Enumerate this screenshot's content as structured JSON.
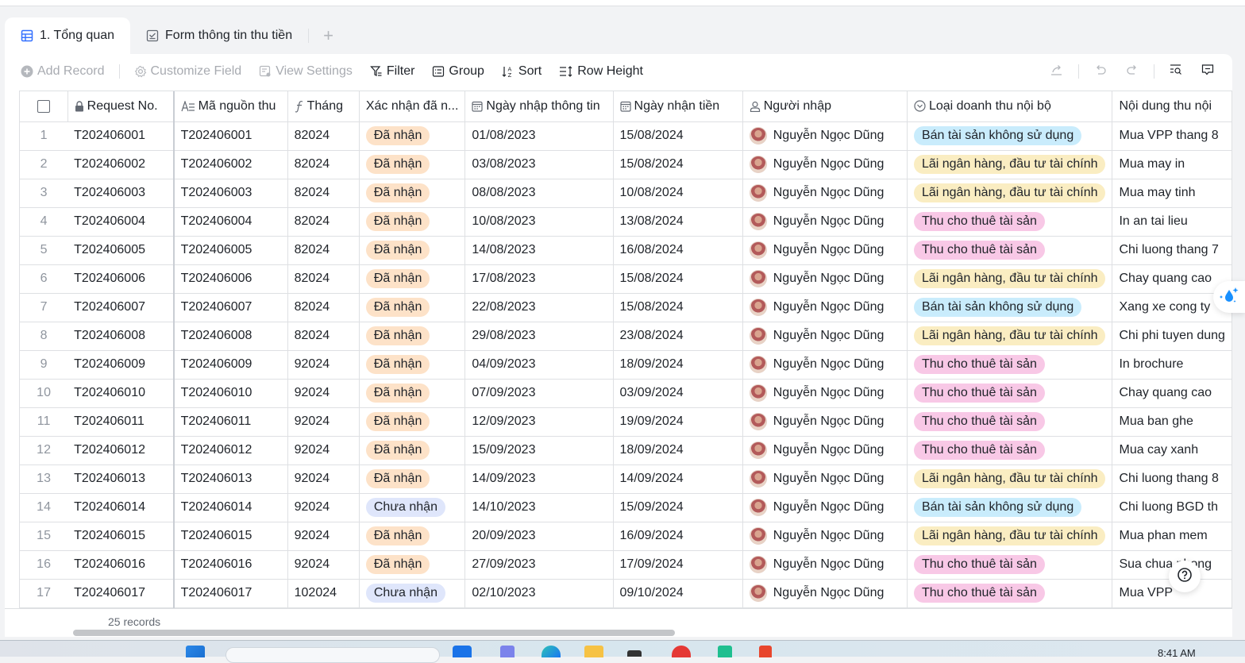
{
  "tabs": [
    {
      "label": "1. Tổng quan",
      "icon": "grid-table-icon",
      "active": true
    },
    {
      "label": "Form thông tin thu tiền",
      "icon": "form-check-icon",
      "active": false
    }
  ],
  "add_tab_label": "+",
  "toolbar": {
    "add_record": "Add Record",
    "customize_field": "Customize Field",
    "view_settings": "View Settings",
    "filter": "Filter",
    "group": "Group",
    "sort": "Sort",
    "row_height": "Row Height"
  },
  "columns": [
    {
      "key": "request_no",
      "label": "Request No.",
      "icon": "lock-icon"
    },
    {
      "key": "ma_nguon_thu",
      "label": "Mã nguồn thu",
      "icon": "text-field-icon"
    },
    {
      "key": "thang",
      "label": "Tháng",
      "icon": "formula-icon"
    },
    {
      "key": "xac_nhan",
      "label": "Xác nhận đã n...",
      "icon": ""
    },
    {
      "key": "ngay_nhap",
      "label": "Ngày nhập thông tin",
      "icon": "calendar-icon"
    },
    {
      "key": "ngay_nhan",
      "label": "Ngày nhận tiền",
      "icon": "calendar-icon"
    },
    {
      "key": "nguoi_nhap",
      "label": "Người nhập",
      "icon": "person-icon"
    },
    {
      "key": "loai_doanh_thu",
      "label": "Loại doanh thu nội bộ",
      "icon": "single-select-icon"
    },
    {
      "key": "noi_dung",
      "label": "Nội dung thu nội",
      "icon": ""
    }
  ],
  "status_colors": {
    "Đã nhận": "#fde2c8",
    "Chưa nhận": "#dfe6fb"
  },
  "category_colors": {
    "Bán tài sản không sử dụng": "#c9ecfc",
    "Lãi ngân hàng, đầu tư tài chính": "#faedc2",
    "Thu cho thuê tài sản": "#f8c8e6"
  },
  "rows": [
    {
      "idx": "1",
      "request_no": "T202406001",
      "ma_nguon_thu": "T202406001",
      "thang": "82024",
      "xac_nhan": "Đã nhận",
      "ngay_nhap": "01/08/2023",
      "ngay_nhan": "15/08/2024",
      "nguoi_nhap": "Nguyễn Ngọc Dũng",
      "loai_doanh_thu": "Bán tài sản không sử dụng",
      "noi_dung": "Mua VPP thang 8"
    },
    {
      "idx": "2",
      "request_no": "T202406002",
      "ma_nguon_thu": "T202406002",
      "thang": "82024",
      "xac_nhan": "Đã nhận",
      "ngay_nhap": "03/08/2023",
      "ngay_nhan": "15/08/2024",
      "nguoi_nhap": "Nguyễn Ngọc Dũng",
      "loai_doanh_thu": "Lãi ngân hàng, đầu tư tài chính",
      "noi_dung": "Mua may in"
    },
    {
      "idx": "3",
      "request_no": "T202406003",
      "ma_nguon_thu": "T202406003",
      "thang": "82024",
      "xac_nhan": "Đã nhận",
      "ngay_nhap": "08/08/2023",
      "ngay_nhan": "10/08/2024",
      "nguoi_nhap": "Nguyễn Ngọc Dũng",
      "loai_doanh_thu": "Lãi ngân hàng, đầu tư tài chính",
      "noi_dung": "Mua may tinh"
    },
    {
      "idx": "4",
      "request_no": "T202406004",
      "ma_nguon_thu": "T202406004",
      "thang": "82024",
      "xac_nhan": "Đã nhận",
      "ngay_nhap": "10/08/2023",
      "ngay_nhan": "13/08/2024",
      "nguoi_nhap": "Nguyễn Ngọc Dũng",
      "loai_doanh_thu": "Thu cho thuê tài sản",
      "noi_dung": "In an tai lieu"
    },
    {
      "idx": "5",
      "request_no": "T202406005",
      "ma_nguon_thu": "T202406005",
      "thang": "82024",
      "xac_nhan": "Đã nhận",
      "ngay_nhap": "14/08/2023",
      "ngay_nhan": "16/08/2024",
      "nguoi_nhap": "Nguyễn Ngọc Dũng",
      "loai_doanh_thu": "Thu cho thuê tài sản",
      "noi_dung": "Chi luong thang 7"
    },
    {
      "idx": "6",
      "request_no": "T202406006",
      "ma_nguon_thu": "T202406006",
      "thang": "82024",
      "xac_nhan": "Đã nhận",
      "ngay_nhap": "17/08/2023",
      "ngay_nhan": "15/08/2024",
      "nguoi_nhap": "Nguyễn Ngọc Dũng",
      "loai_doanh_thu": "Lãi ngân hàng, đầu tư tài chính",
      "noi_dung": "Chay quang cao"
    },
    {
      "idx": "7",
      "request_no": "T202406007",
      "ma_nguon_thu": "T202406007",
      "thang": "82024",
      "xac_nhan": "Đã nhận",
      "ngay_nhap": "22/08/2023",
      "ngay_nhan": "15/08/2024",
      "nguoi_nhap": "Nguyễn Ngọc Dũng",
      "loai_doanh_thu": "Bán tài sản không sử dụng",
      "noi_dung": "Xang xe cong ty"
    },
    {
      "idx": "8",
      "request_no": "T202406008",
      "ma_nguon_thu": "T202406008",
      "thang": "82024",
      "xac_nhan": "Đã nhận",
      "ngay_nhap": "29/08/2023",
      "ngay_nhan": "23/08/2024",
      "nguoi_nhap": "Nguyễn Ngọc Dũng",
      "loai_doanh_thu": "Lãi ngân hàng, đầu tư tài chính",
      "noi_dung": "Chi phi tuyen dung"
    },
    {
      "idx": "9",
      "request_no": "T202406009",
      "ma_nguon_thu": "T202406009",
      "thang": "92024",
      "xac_nhan": "Đã nhận",
      "ngay_nhap": "04/09/2023",
      "ngay_nhan": "18/09/2024",
      "nguoi_nhap": "Nguyễn Ngọc Dũng",
      "loai_doanh_thu": "Thu cho thuê tài sản",
      "noi_dung": "In brochure"
    },
    {
      "idx": "10",
      "request_no": "T202406010",
      "ma_nguon_thu": "T202406010",
      "thang": "92024",
      "xac_nhan": "Đã nhận",
      "ngay_nhap": "07/09/2023",
      "ngay_nhan": "03/09/2024",
      "nguoi_nhap": "Nguyễn Ngọc Dũng",
      "loai_doanh_thu": "Thu cho thuê tài sản",
      "noi_dung": "Chay quang cao"
    },
    {
      "idx": "11",
      "request_no": "T202406011",
      "ma_nguon_thu": "T202406011",
      "thang": "92024",
      "xac_nhan": "Đã nhận",
      "ngay_nhap": "12/09/2023",
      "ngay_nhan": "19/09/2024",
      "nguoi_nhap": "Nguyễn Ngọc Dũng",
      "loai_doanh_thu": "Thu cho thuê tài sản",
      "noi_dung": "Mua ban ghe"
    },
    {
      "idx": "12",
      "request_no": "T202406012",
      "ma_nguon_thu": "T202406012",
      "thang": "92024",
      "xac_nhan": "Đã nhận",
      "ngay_nhap": "15/09/2023",
      "ngay_nhan": "18/09/2024",
      "nguoi_nhap": "Nguyễn Ngọc Dũng",
      "loai_doanh_thu": "Thu cho thuê tài sản",
      "noi_dung": "Mua cay xanh"
    },
    {
      "idx": "13",
      "request_no": "T202406013",
      "ma_nguon_thu": "T202406013",
      "thang": "92024",
      "xac_nhan": "Đã nhận",
      "ngay_nhap": "14/09/2023",
      "ngay_nhan": "14/09/2024",
      "nguoi_nhap": "Nguyễn Ngọc Dũng",
      "loai_doanh_thu": "Lãi ngân hàng, đầu tư tài chính",
      "noi_dung": "Chi luong thang 8"
    },
    {
      "idx": "14",
      "request_no": "T202406014",
      "ma_nguon_thu": "T202406014",
      "thang": "92024",
      "xac_nhan": "Chưa nhận",
      "ngay_nhap": "14/10/2023",
      "ngay_nhan": "15/09/2024",
      "nguoi_nhap": "Nguyễn Ngọc Dũng",
      "loai_doanh_thu": "Bán tài sản không sử dụng",
      "noi_dung": "Chi luong BGD th"
    },
    {
      "idx": "15",
      "request_no": "T202406015",
      "ma_nguon_thu": "T202406015",
      "thang": "92024",
      "xac_nhan": "Đã nhận",
      "ngay_nhap": "20/09/2023",
      "ngay_nhan": "16/09/2024",
      "nguoi_nhap": "Nguyễn Ngọc Dũng",
      "loai_doanh_thu": "Lãi ngân hàng, đầu tư tài chính",
      "noi_dung": "Mua phan mem"
    },
    {
      "idx": "16",
      "request_no": "T202406016",
      "ma_nguon_thu": "T202406016",
      "thang": "92024",
      "xac_nhan": "Đã nhận",
      "ngay_nhap": "27/09/2023",
      "ngay_nhan": "17/09/2024",
      "nguoi_nhap": "Nguyễn Ngọc Dũng",
      "loai_doanh_thu": "Thu cho thuê tài sản",
      "noi_dung": "Sua chua phong"
    },
    {
      "idx": "17",
      "request_no": "T202406017",
      "ma_nguon_thu": "T202406017",
      "thang": "102024",
      "xac_nhan": "Chưa nhận",
      "ngay_nhap": "02/10/2023",
      "ngay_nhan": "09/10/2024",
      "nguoi_nhap": "Nguyễn Ngọc Dũng",
      "loai_doanh_thu": "Thu cho thuê tài sản",
      "noi_dung": "Mua VPP"
    }
  ],
  "footer": {
    "records": "25 records"
  },
  "taskbar": {
    "clock": "8:41 AM"
  }
}
